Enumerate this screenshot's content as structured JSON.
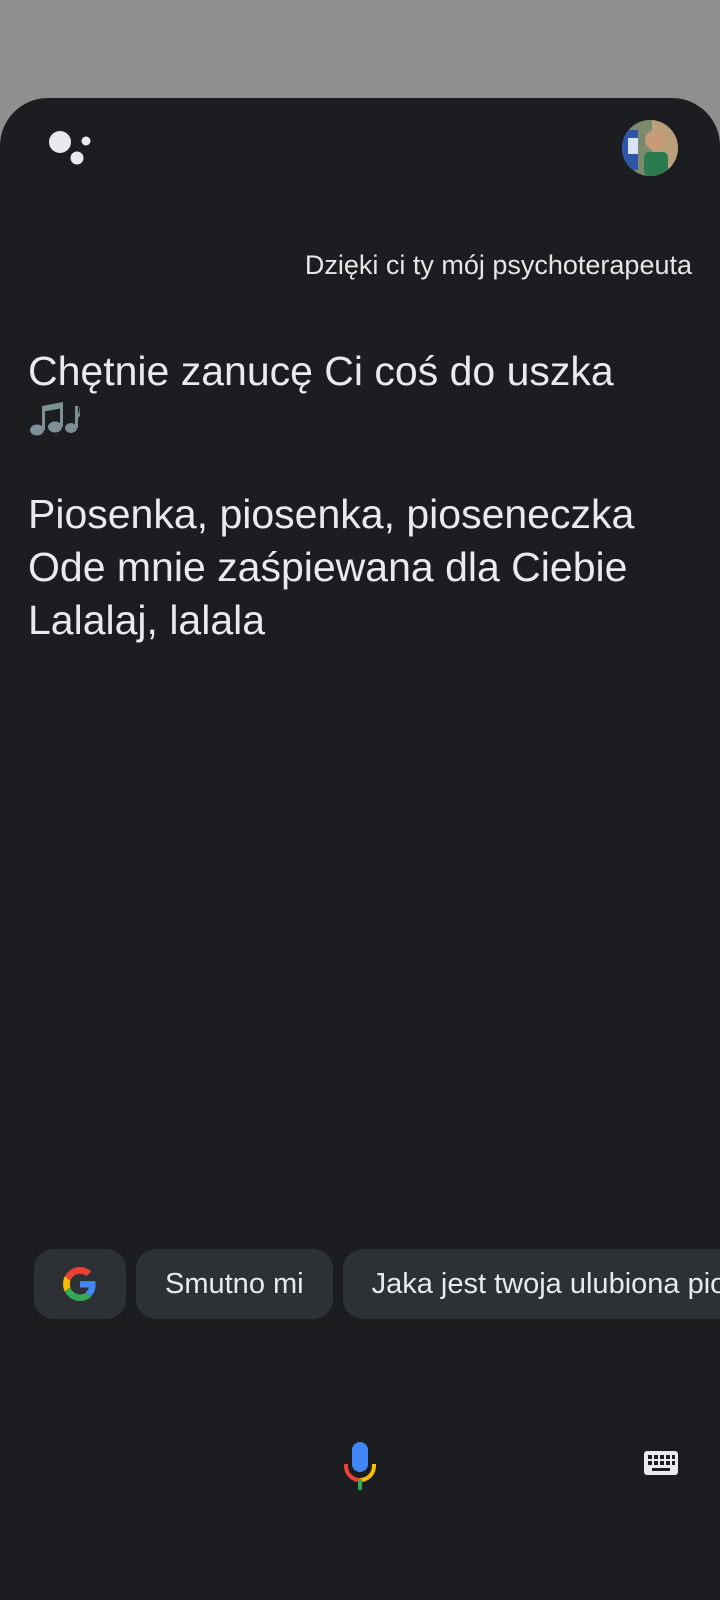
{
  "conversation": {
    "user_query": "Dzięki ci ty mój psychoterapeuta",
    "reply_lines": [
      "Chętnie zanucę Ci coś do uszka",
      "Piosenka, piosenka, pioseneczka",
      "Ode mnie zaśpiewana dla Ciebie",
      "Lalalaj, lalala"
    ],
    "music_notes_icon": "music-notes-icon"
  },
  "suggestions": {
    "google_icon": "google-g-icon",
    "chips": [
      "Smutno mi",
      "Jaka jest twoja ulubiona piosenka"
    ]
  },
  "icons": {
    "assistant": "assistant-dots-icon",
    "avatar": "user-avatar",
    "mic": "microphone-icon",
    "keyboard": "keyboard-icon"
  },
  "colors": {
    "sheet_bg": "#1b1d20",
    "chip_bg": "#2d3034",
    "text": "#e8eaed",
    "google_blue": "#4285F4",
    "google_red": "#EA4335",
    "google_yellow": "#FBBC05",
    "google_green": "#34A853"
  }
}
